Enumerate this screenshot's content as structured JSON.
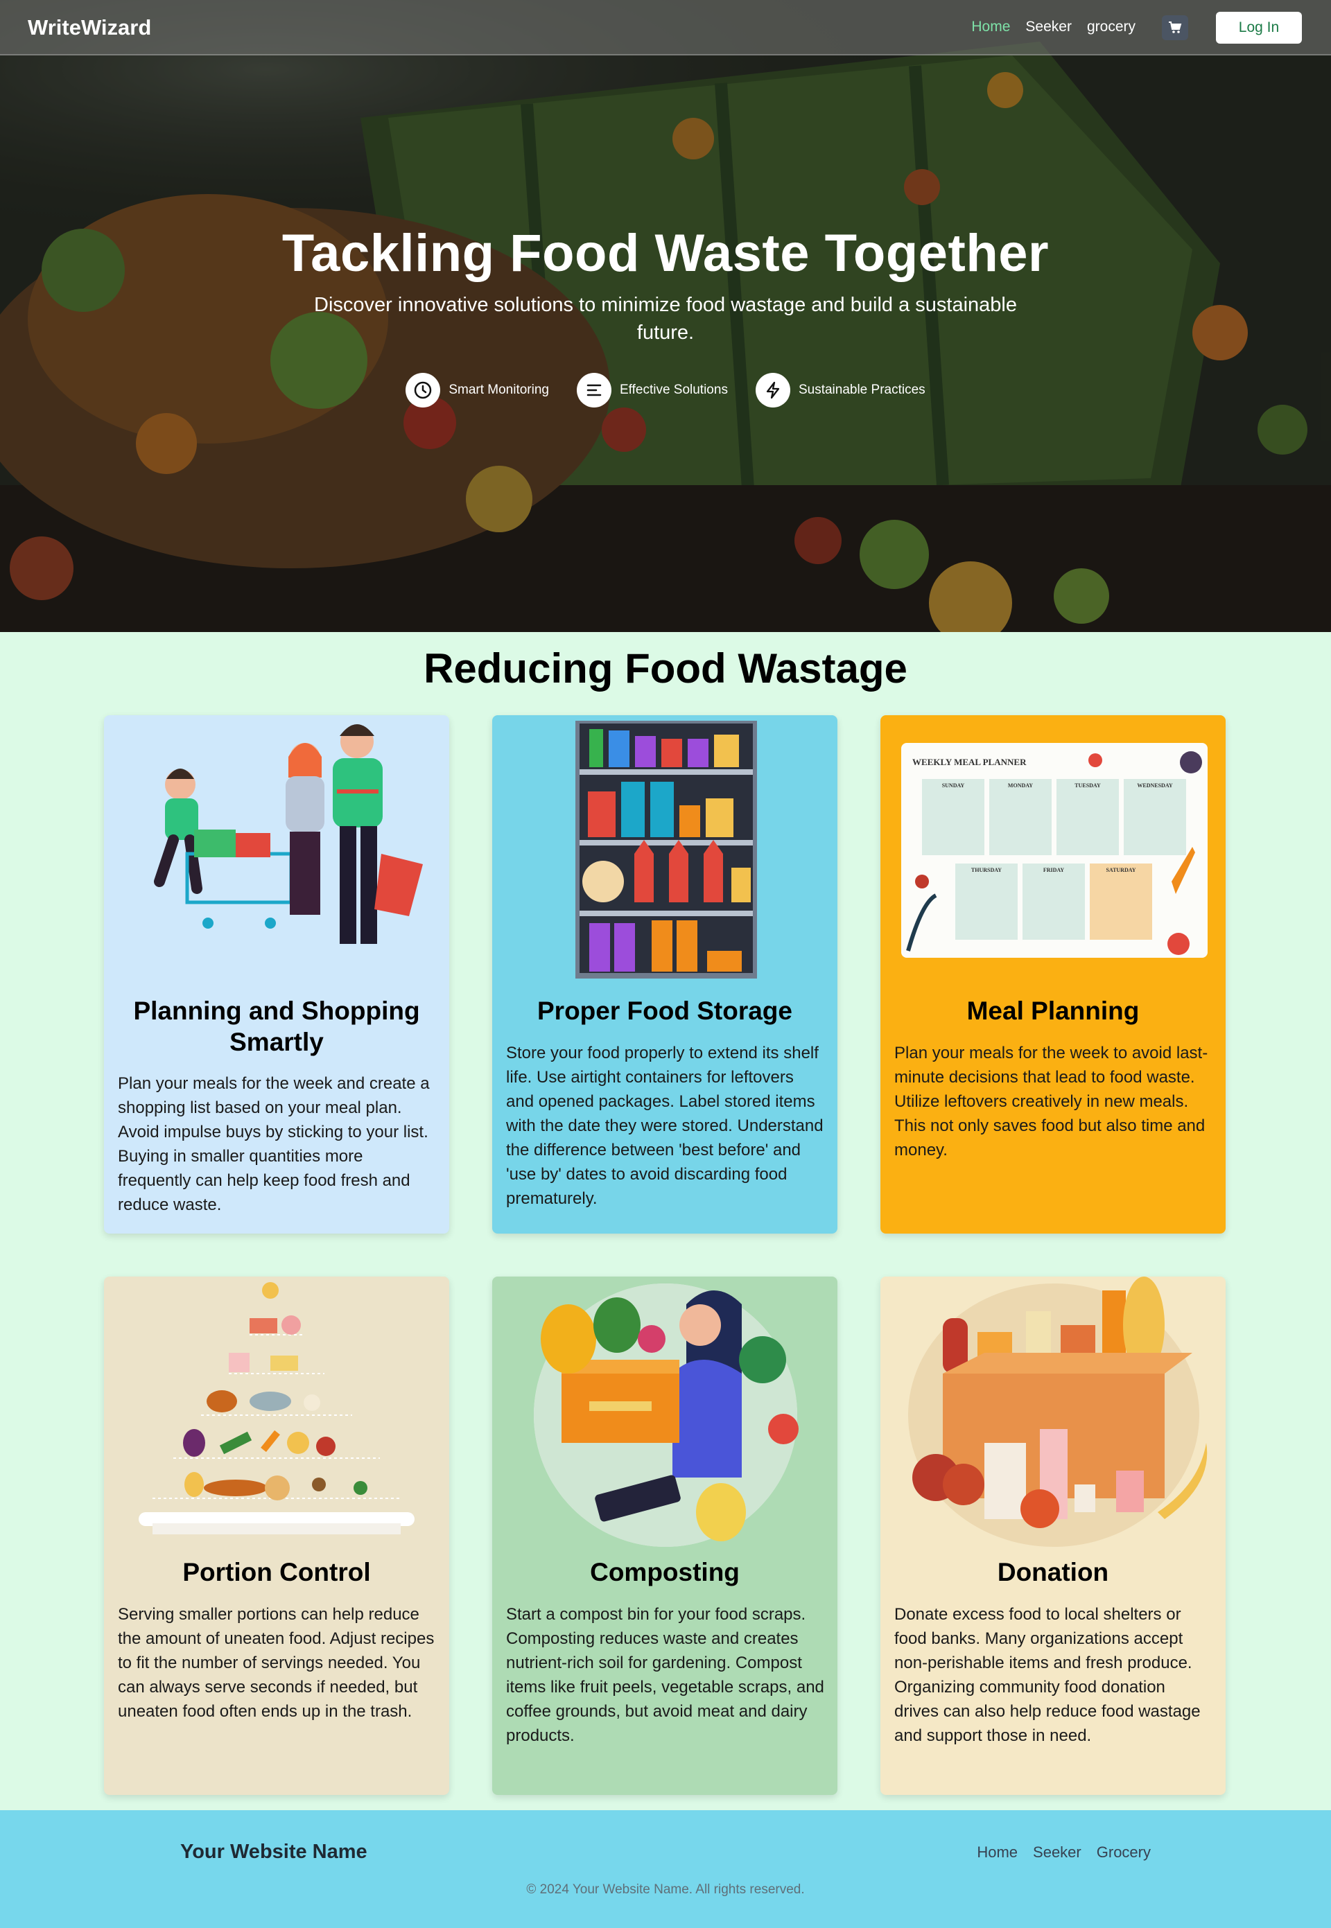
{
  "nav": {
    "brand": "WriteWizard",
    "links": [
      "Home",
      "Seeker",
      "grocery"
    ],
    "active": "Home",
    "cart_icon": "cart-icon",
    "login_label": "Log In"
  },
  "hero": {
    "title": "Tackling Food Waste Together",
    "subtitle": "Discover innovative solutions to minimize food wastage and build a sustainable future.",
    "features": [
      {
        "icon": "clock-icon",
        "label": "Smart Monitoring"
      },
      {
        "icon": "lines-icon",
        "label": "Effective Solutions"
      },
      {
        "icon": "bolt-icon",
        "label": "Sustainable Practices"
      }
    ]
  },
  "section": {
    "title": "Reducing Food Wastage"
  },
  "cards": [
    {
      "title": "Planning and Shopping Smartly",
      "text": "Plan your meals for the week and create a shopping list based on your meal plan. Avoid impulse buys by sticking to your list. Buying in smaller quantities more frequently can help keep food fresh and reduce waste.",
      "bg": "#cfe8fb",
      "art": "family-shopping-illustration"
    },
    {
      "title": "Proper Food Storage",
      "text": "Store your food properly to extend its shelf life. Use airtight containers for leftovers and opened packages. Label stored items with the date they were stored. Understand the difference between 'best before' and 'use by' dates to avoid discarding food prematurely.",
      "bg": "#77d5e9",
      "art": "pantry-shelf-illustration"
    },
    {
      "title": "Meal Planning",
      "text": "Plan your meals for the week to avoid last-minute decisions that lead to food waste. Utilize leftovers creatively in new meals. This not only saves food but also time and money.",
      "bg": "#fbb012",
      "art": "weekly-meal-planner-illustration"
    },
    {
      "title": "Portion Control",
      "text": "Serving smaller portions can help reduce the amount of uneaten food. Adjust recipes to fit the number of servings needed. You can always serve seconds if needed, but uneaten food often ends up in the trash.",
      "bg": "#ece3c9",
      "art": "food-pyramid-illustration"
    },
    {
      "title": "Composting",
      "text": "Start a compost bin for your food scraps. Composting reduces waste and creates nutrient-rich soil for gardening. Compost items like fruit peels, vegetable scraps, and coffee grounds, but avoid meat and dairy products.",
      "bg": "#aedbb4",
      "art": "woman-with-produce-box-illustration"
    },
    {
      "title": "Donation",
      "text": "Donate excess food to local shelters or food banks. Many organizations accept non-perishable items and fresh produce. Organizing community food donation drives can also help reduce food wastage and support those in need.",
      "bg": "#f5e8c6",
      "art": "donation-box-illustration"
    }
  ],
  "planner_art": {
    "heading": "WEEKLY MEAL PLANNER",
    "days": [
      "SUNDAY",
      "MONDAY",
      "TUESDAY",
      "WEDNESDAY",
      "THURSDAY",
      "FRIDAY",
      "SATURDAY"
    ]
  },
  "footer": {
    "brand": "Your Website Name",
    "links": [
      "Home",
      "Seeker",
      "Grocery"
    ],
    "copyright": "© 2024 Your Website Name. All rights reserved."
  }
}
